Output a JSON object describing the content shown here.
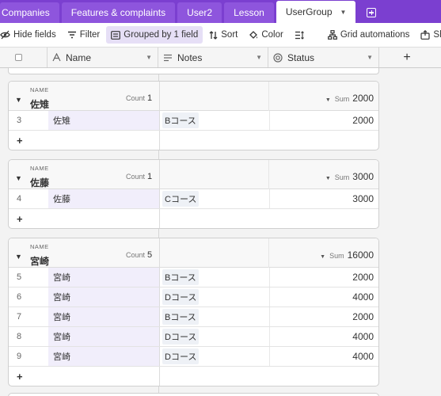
{
  "tabs": [
    {
      "label": "Companies",
      "active": false
    },
    {
      "label": "Features & complaints",
      "active": false
    },
    {
      "label": "User2",
      "active": false
    },
    {
      "label": "Lesson",
      "active": false
    },
    {
      "label": "UserGroup",
      "active": true
    }
  ],
  "toolbar": {
    "hide_fields": "Hide fields",
    "filter": "Filter",
    "grouped": "Grouped by 1 field",
    "sort": "Sort",
    "color": "Color",
    "grid_automations": "Grid automations",
    "share": "Sha"
  },
  "columns": {
    "name": "Name",
    "notes": "Notes",
    "status": "Status",
    "add": "+"
  },
  "groups": [
    {
      "field": "NAME",
      "value": "佐雉",
      "count_label": "Count",
      "count": "1",
      "sum_label": "Sum",
      "sum": "2000",
      "rows": [
        {
          "num": "3",
          "name": "佐雉",
          "notes": "Bコース",
          "status": "2000"
        }
      ]
    },
    {
      "field": "NAME",
      "value": "佐藤",
      "count_label": "Count",
      "count": "1",
      "sum_label": "Sum",
      "sum": "3000",
      "rows": [
        {
          "num": "4",
          "name": "佐藤",
          "notes": "Cコース",
          "status": "3000"
        }
      ]
    },
    {
      "field": "NAME",
      "value": "宮崎",
      "count_label": "Count",
      "count": "5",
      "sum_label": "Sum",
      "sum": "16000",
      "rows": [
        {
          "num": "5",
          "name": "宮崎",
          "notes": "Bコース",
          "status": "2000"
        },
        {
          "num": "6",
          "name": "宮崎",
          "notes": "Dコース",
          "status": "4000"
        },
        {
          "num": "7",
          "name": "宮崎",
          "notes": "Bコース",
          "status": "2000"
        },
        {
          "num": "8",
          "name": "宮崎",
          "notes": "Dコース",
          "status": "4000"
        },
        {
          "num": "9",
          "name": "宮崎",
          "notes": "Dコース",
          "status": "4000"
        }
      ]
    }
  ],
  "add_row_label": "+",
  "colors": {
    "accent": "#7b3fd0",
    "active_button": "#e6dff6",
    "name_cell": "#f1eefb"
  }
}
